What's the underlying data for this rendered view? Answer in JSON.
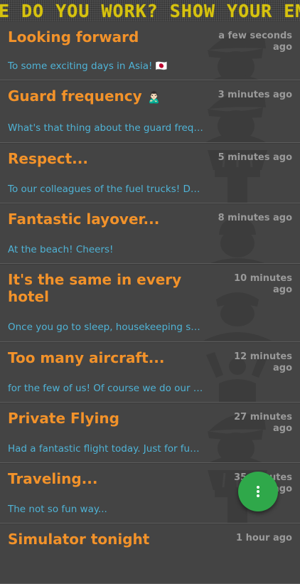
{
  "ticker": {
    "text": "E DO YOU WORK? SHOW YOUR EM"
  },
  "posts": [
    {
      "title": "Looking forward",
      "time": "a few seconds ago",
      "excerpt": "To some exciting days in Asia! 🇯🇵",
      "art": "pilot-cap-silhouette"
    },
    {
      "title": "Guard frequency",
      "title_emoji": "🙎🏻‍♂️",
      "time": "3 minutes ago",
      "excerpt": "What's that thing about the guard frequ...",
      "art": "pilot-cap-silhouette"
    },
    {
      "title": "Respect...",
      "time": "5 minutes ago",
      "excerpt": "To our colleagues of the fuel trucks! De...",
      "art": "control-tower-silhouette"
    },
    {
      "title": "Fantastic layover...",
      "time": "8 minutes ago",
      "excerpt": "At the beach! Cheers!",
      "art": "person-silhouette"
    },
    {
      "title": "It's the same in every hotel",
      "time": "10 minutes ago",
      "excerpt": "Once you go to sleep, housekeeping st...",
      "art": "flight-attendant-silhouette"
    },
    {
      "title": "Too many aircraft...",
      "time": "12 minutes ago",
      "excerpt": "for the few of us! Of course we do our b...",
      "art": "marshaller-silhouette"
    },
    {
      "title": "Private Flying",
      "time": "27 minutes ago",
      "excerpt": "Had a fantastic flight today. Just for fun...",
      "art": "pilot-cap-silhouette"
    },
    {
      "title": "Traveling...",
      "time": "35 minutes ago",
      "excerpt": "The not so fun way...",
      "art": "control-tower-silhouette"
    },
    {
      "title": "Simulator tonight",
      "time": "1 hour ago",
      "excerpt": "",
      "art": "pilot-cap-silhouette"
    }
  ],
  "fab": {
    "icon": "more-vertical-icon"
  },
  "colors": {
    "title": "#f2922a",
    "excerpt": "#4fb3d6",
    "time": "#9a9a9a",
    "background": "#444444",
    "ticker": "#d6c20f",
    "fab": "#2fa84a"
  }
}
